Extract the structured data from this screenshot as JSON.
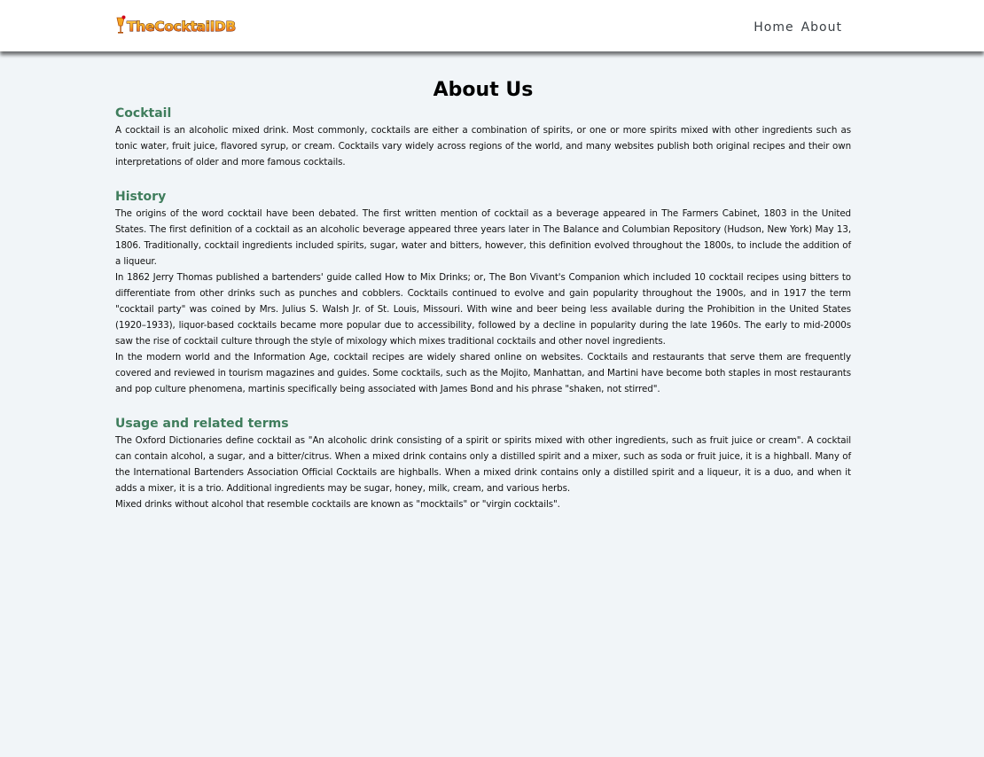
{
  "navbar": {
    "logo_text": "TheCocktailDB",
    "links": [
      {
        "label": "Home"
      },
      {
        "label": "About"
      }
    ]
  },
  "page": {
    "title": "About Us"
  },
  "sections": [
    {
      "heading": "Cocktail",
      "paragraphs": [
        "A cocktail is an alcoholic mixed drink. Most commonly, cocktails are either a combination of spirits, or one or more spirits mixed with other ingredients such as tonic water, fruit juice, flavored syrup, or cream. Cocktails vary widely across regions of the world, and many websites publish both original recipes and their own interpretations of older and more famous cocktails."
      ]
    },
    {
      "heading": "History",
      "paragraphs": [
        "The origins of the word cocktail have been debated. The first written mention of cocktail as a beverage appeared in The Farmers Cabinet, 1803 in the United States. The first definition of a cocktail as an alcoholic beverage appeared three years later in The Balance and Columbian Repository (Hudson, New York) May 13, 1806. Traditionally, cocktail ingredients included spirits, sugar, water and bitters, however, this definition evolved throughout the 1800s, to include the addition of a liqueur.",
        "In 1862 Jerry Thomas published a bartenders' guide called How to Mix Drinks; or, The Bon Vivant's Companion which included 10 cocktail recipes using bitters to differentiate from other drinks such as punches and cobblers. Cocktails continued to evolve and gain popularity throughout the 1900s, and in 1917 the term \"cocktail party\" was coined by Mrs. Julius S. Walsh Jr. of St. Louis, Missouri. With wine and beer being less available during the Prohibition in the United States (1920–1933), liquor-based cocktails became more popular due to accessibility, followed by a decline in popularity during the late 1960s. The early to mid-2000s saw the rise of cocktail culture through the style of mixology which mixes traditional cocktails and other novel ingredients.",
        "In the modern world and the Information Age, cocktail recipes are widely shared online on websites. Cocktails and restaurants that serve them are frequently covered and reviewed in tourism magazines and guides. Some cocktails, such as the Mojito, Manhattan, and Martini have become both staples in most restaurants and pop culture phenomena, martinis specifically being associated with James Bond and his phrase \"shaken, not stirred\"."
      ]
    },
    {
      "heading": "Usage and related terms",
      "paragraphs": [
        "The Oxford Dictionaries define cocktail as \"An alcoholic drink consisting of a spirit or spirits mixed with other ingredients, such as fruit juice or cream\". A cocktail can contain alcohol, a sugar, and a bitter/citrus. When a mixed drink contains only a distilled spirit and a mixer, such as soda or fruit juice, it is a highball. Many of the International Bartenders Association Official Cocktails are highballs. When a mixed drink contains only a distilled spirit and a liqueur, it is a duo, and when it adds a mixer, it is a trio. Additional ingredients may be sugar, honey, milk, cream, and various herbs.",
        "Mixed drinks without alcohol that resemble cocktails are known as \"mocktails\" or \"virgin cocktails\"."
      ]
    }
  ],
  "colors": {
    "background": "#f1f5f8",
    "heading_green": "#3f7d5c",
    "logo_orange": "#f5a623",
    "logo_red": "#d0021b"
  }
}
